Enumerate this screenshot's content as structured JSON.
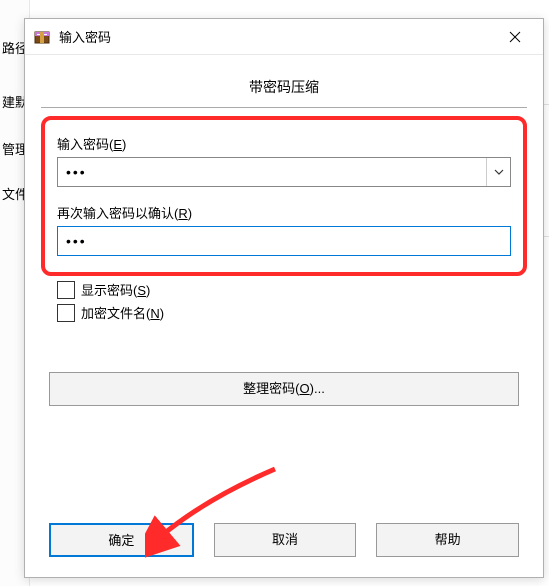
{
  "bgTextTop": "路径",
  "bgLabels": {
    "l1": "建默",
    "l2": "管理",
    "l3": "文件"
  },
  "titlebar": {
    "title": "输入密码"
  },
  "section": {
    "heading": "带密码压缩"
  },
  "password": {
    "label_pre": "输入密码(",
    "label_key": "E",
    "label_post": ")",
    "value": "•••"
  },
  "confirm": {
    "label_pre": "再次输入密码以确认(",
    "label_key": "R",
    "label_post": ")",
    "value": "•••"
  },
  "checks": {
    "show_pre": "显示密码(",
    "show_key": "S",
    "show_post": ")",
    "encrypt_pre": "加密文件名(",
    "encrypt_key": "N",
    "encrypt_post": ")"
  },
  "organize": {
    "label_pre": "整理密码(",
    "label_key": "O",
    "label_post": ")..."
  },
  "buttons": {
    "ok": "确定",
    "cancel": "取消",
    "help": "帮助"
  }
}
